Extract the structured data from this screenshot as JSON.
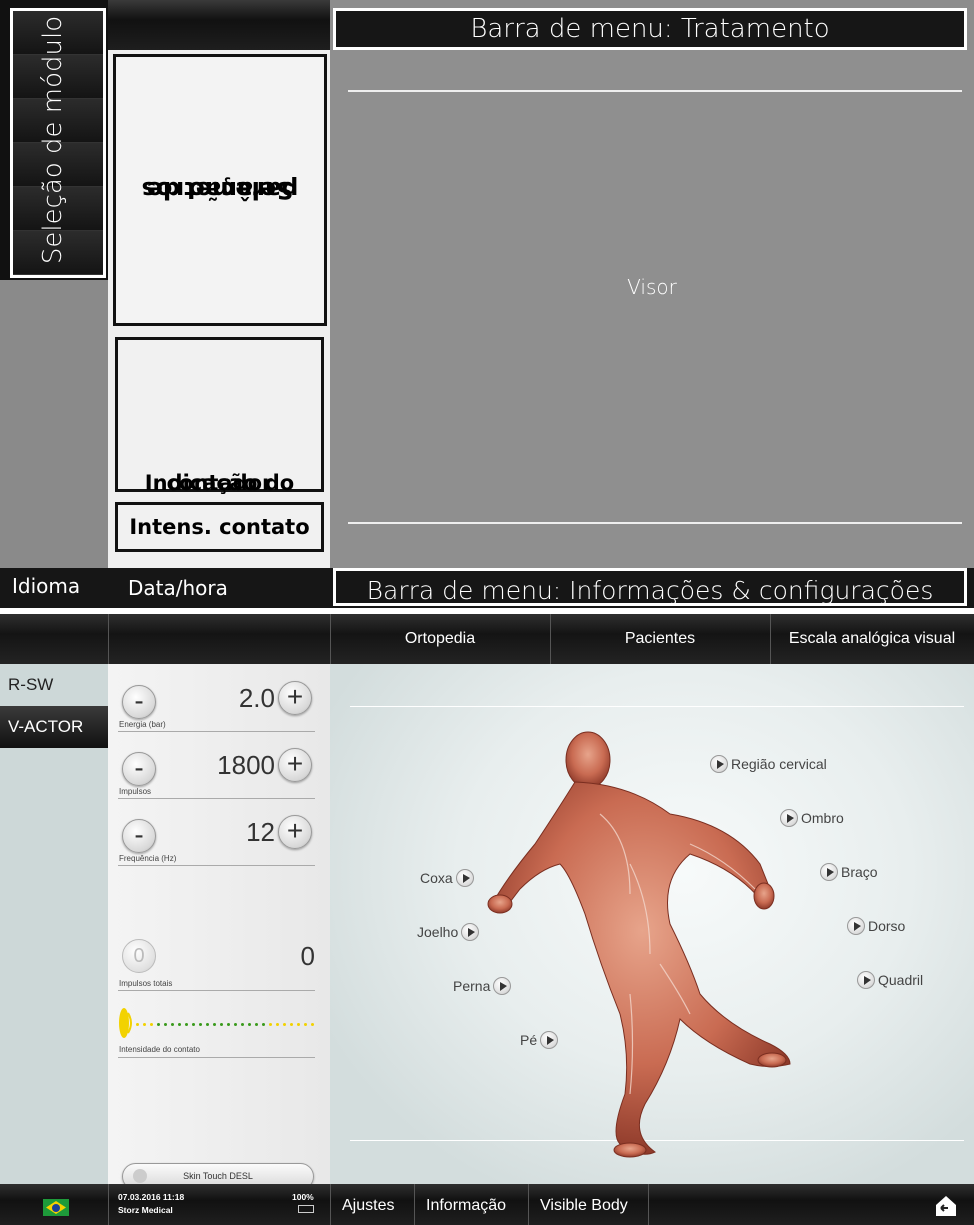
{
  "diagram": {
    "top_bar": "Barra de menu: Tratamento",
    "module_selection": "Seleção de módulo",
    "param_selection_line1": "Seleção de",
    "param_selection_line2": "parâmetros",
    "counter_line1": "Indicação do",
    "counter_line2": "contador",
    "contact_intensity": "Intens. contato",
    "display": "Visor",
    "language": "Idioma",
    "datetime": "Data/hora",
    "bottom_bar": "Barra de menu: Informações & configurações"
  },
  "app": {
    "tabs": [
      "Ortopedia",
      "Pacientes",
      "Escala analógica visual"
    ],
    "modules": [
      {
        "label": "R-SW",
        "active": false
      },
      {
        "label": "V-ACTOR",
        "active": true
      }
    ],
    "params": {
      "energy": {
        "value": "2.0",
        "label": "Energia (bar)"
      },
      "impulses": {
        "value": "1800",
        "label": "Impulsos"
      },
      "frequency": {
        "value": "12",
        "label": "Frequência (Hz)"
      },
      "total": {
        "value": "0",
        "label": "Impulsos totais",
        "reset_glyph": "0"
      },
      "contact": {
        "label": "Intensidade do contato",
        "level_fraction": 0.6
      },
      "minus_glyph": "-",
      "plus_glyph": "+",
      "skin_touch": "Skin Touch DESL"
    },
    "regions_right": [
      "Região cervical",
      "Ombro",
      "Braço",
      "Dorso",
      "Quadril"
    ],
    "regions_left": [
      "Coxa",
      "Joelho",
      "Perna",
      "Pé"
    ],
    "status": {
      "date": "07.03.2016 11:18",
      "company": "Storz Medical",
      "battery": "100%"
    },
    "bottom_menu": [
      "Ajustes",
      "Informação",
      "Visible Body"
    ],
    "colors": {
      "contact_green": "#3a9a1c",
      "contact_yellow": "#f2d200",
      "panel_teal": "#cdd8d8"
    },
    "icons": [
      "flag-brazil-icon",
      "battery-icon",
      "home-return-icon",
      "play-icon",
      "sound-icon"
    ]
  }
}
